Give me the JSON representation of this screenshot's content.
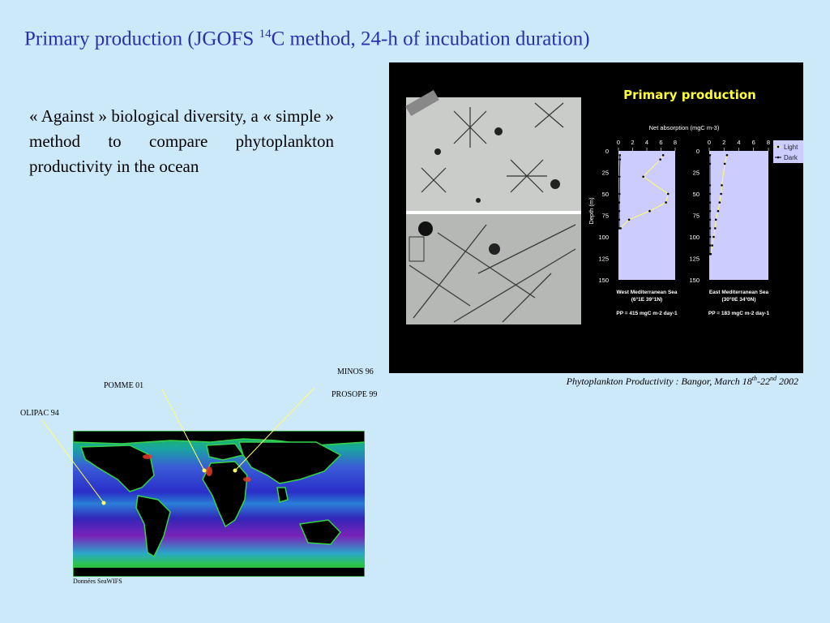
{
  "slide": {
    "title_pre": "Primary production (JGOFS ",
    "title_sup": "14",
    "title_post": "C method, 24-h of incubation duration)",
    "body": "« Against » biological diversity, a « simple » method to compare phytoplankton productivity in the ocean",
    "caption_pre": "Phytoplankton Productivity : Bangor, March 18",
    "caption_sup1": "th",
    "caption_mid": "-22",
    "caption_sup2": "nd",
    "caption_post": " 2002"
  },
  "map": {
    "labels": {
      "olipac": "OLIPAC 94",
      "pomme": "POMME 01",
      "minos": "MINOS 96",
      "prosope": "PROSOPE 99"
    },
    "source": "Données SeaWIFS"
  },
  "chart_data": {
    "type": "line",
    "title": "Primary production",
    "xlabel": "Net absorption (mgC m-3)",
    "ylabel": "Depth (m)",
    "legend": [
      "Light",
      "Dark"
    ],
    "legend_position": "top-right",
    "xlim": [
      0,
      8
    ],
    "ylim": [
      150,
      0
    ],
    "x_ticks": [
      "0",
      "2",
      "4",
      "6",
      "8"
    ],
    "y_ticks": [
      "0",
      "25",
      "50",
      "75",
      "100",
      "125",
      "150"
    ],
    "panels": [
      {
        "name": "West Mediterranean Sea",
        "coords": "(6°1E 39°1N)",
        "pp_label": "PP = 415 mgC m-2 day-1",
        "series": [
          {
            "name": "Light",
            "depth": [
              5,
              10,
              30,
              50,
              60,
              70,
              80,
              90
            ],
            "values": [
              6.3,
              5.9,
              3.5,
              7.0,
              6.7,
              4.4,
              1.5,
              0.3
            ]
          },
          {
            "name": "Dark",
            "depth": [
              5,
              10,
              30,
              50,
              60,
              70,
              80,
              90
            ],
            "values": [
              0.2,
              0.2,
              0.15,
              0.15,
              0.1,
              0.1,
              0.1,
              0.1
            ]
          }
        ]
      },
      {
        "name": "East Mediterranean Sea",
        "coords": "(30°0E 34°0N)",
        "pp_label": "PP = 183 mgC m-2 day-1",
        "series": [
          {
            "name": "Light",
            "depth": [
              5,
              15,
              40,
              50,
              60,
              70,
              80,
              90,
              100,
              110,
              120
            ],
            "values": [
              2.4,
              2.1,
              1.7,
              1.6,
              1.4,
              1.2,
              0.9,
              0.8,
              0.6,
              0.4,
              0.2
            ]
          },
          {
            "name": "Dark",
            "depth": [
              5,
              15,
              40,
              50,
              60,
              70,
              80,
              90,
              100,
              110,
              120
            ],
            "values": [
              0.1,
              0.1,
              0.1,
              0.1,
              0.1,
              0.1,
              0.1,
              0.1,
              0.1,
              0.1,
              0.1
            ]
          }
        ]
      }
    ]
  }
}
